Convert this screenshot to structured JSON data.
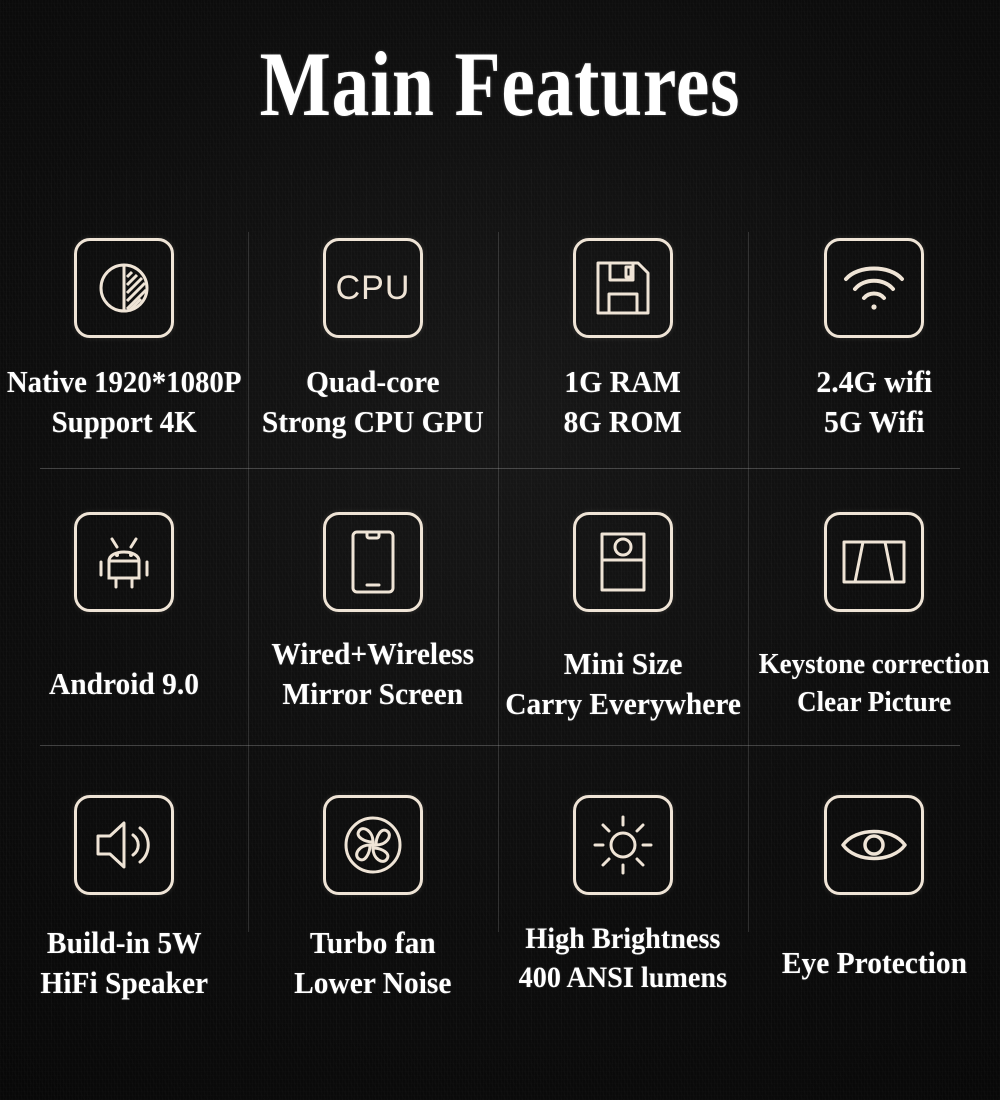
{
  "page": {
    "title": "Main Features",
    "background_color": "#0d0d0d",
    "text_color": "#ffffff",
    "icon_color": "#efe4d6",
    "divider_color": "#bebebe"
  },
  "grid": {
    "columns": 4,
    "rows": 3
  },
  "features": [
    {
      "icon": "contrast-resolution-icon",
      "lines": [
        "Native 1920*1080P",
        "Support 4K"
      ]
    },
    {
      "icon": "cpu-icon",
      "lines": [
        "Quad-core",
        "Strong CPU GPU"
      ]
    },
    {
      "icon": "floppy-disk-icon",
      "lines": [
        "1G RAM",
        "8G ROM"
      ]
    },
    {
      "icon": "wifi-icon",
      "lines": [
        "2.4G wifi",
        "5G Wifi"
      ]
    },
    {
      "icon": "android-robot-icon",
      "lines": [
        "Android 9.0"
      ]
    },
    {
      "icon": "smartphone-icon",
      "lines": [
        "Wired+Wireless",
        "Mirror Screen"
      ]
    },
    {
      "icon": "mini-projector-icon",
      "lines": [
        "Mini Size",
        "Carry Everywhere"
      ]
    },
    {
      "icon": "keystone-trapezoid-icon",
      "lines": [
        "Keystone correction",
        "Clear Picture"
      ]
    },
    {
      "icon": "speaker-icon",
      "lines": [
        "Build-in 5W",
        "HiFi Speaker"
      ]
    },
    {
      "icon": "fan-icon",
      "lines": [
        "Turbo fan",
        "Lower Noise"
      ]
    },
    {
      "icon": "brightness-sun-icon",
      "lines": [
        "High Brightness",
        "400 ANSI lumens"
      ]
    },
    {
      "icon": "eye-icon",
      "lines": [
        "Eye Protection"
      ]
    }
  ],
  "cpu_icon_label": "CPU"
}
